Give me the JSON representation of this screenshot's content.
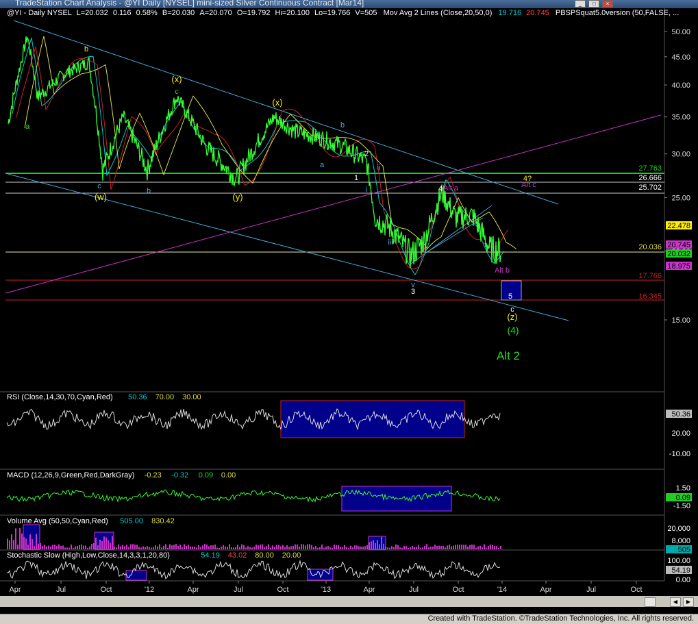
{
  "window": {
    "title": "TradeStation Chart Analysis - @YI Daily [NYSEL] mini-sized Silver Continuous Contract [Mar14]",
    "credit": "Created with TradeStation. ©TradeStation Technologies, Inc. All rights reserved."
  },
  "header": {
    "symbol": "@YI - Daily  NYSEL",
    "last": "L=20.032",
    "chg": "0.116",
    "pct": "0.58%",
    "bid": "B=20.030",
    "ask": "A=20.070",
    "open": "O=19.792",
    "hi": "Hi=20.100",
    "lo": "Lo=19.766",
    "vol": "V=505",
    "ma_label": "Mov Avg 2 Lines (Close,20,50,0)",
    "ma1": "19.716",
    "ma2": "20.745",
    "extra": "PBSPSquat5.0version (50,FALSE, ..."
  },
  "colors": {
    "price": "#33ff33",
    "fast_ma": "#00cccc",
    "slow_ma": "#cc2222",
    "long_ma": "#dddd44",
    "channel": "#44aadd",
    "trend_magenta": "#cc33cc",
    "support_green": "#22cc22",
    "support_red": "#cc2222",
    "label_yellow": "#ffee00",
    "label_green": "#22dd22",
    "panel_box": "#00008b"
  },
  "chart_data": [
    {
      "type": "line",
      "title": "@YI Daily price (mini-sized Silver)",
      "x": [
        "Apr'11",
        "Jul",
        "Oct",
        "'12",
        "Apr",
        "Jul",
        "Oct",
        "'13",
        "Apr",
        "Jul",
        "Oct",
        "'14"
      ],
      "series": [
        {
          "name": "Close",
          "values": [
            33,
            44,
            35,
            30,
            32,
            27,
            34,
            31,
            28,
            19.6,
            23,
            20.03
          ]
        }
      ],
      "ylim": [
        13,
        52
      ],
      "y_ticks": [
        "50.00",
        "45.00",
        "40.00",
        "35.00",
        "30.00",
        "25.00",
        "20.00",
        "15.00"
      ],
      "x_ticks": [
        "Apr",
        "Jul",
        "Oct",
        "'12",
        "Apr",
        "Jul",
        "Oct",
        "'13",
        "Apr",
        "Jul",
        "Oct",
        "'14",
        "Apr",
        "Jul",
        "Oct"
      ],
      "levels": [
        {
          "value": "27.763",
          "color": "#22cc22"
        },
        {
          "value": "26.666",
          "color": "#cccccc"
        },
        {
          "value": "25.702",
          "color": "#cccccc"
        },
        {
          "value": "22.478",
          "color": "#dddd44"
        },
        {
          "value": "20.745",
          "color": "#cc33cc"
        },
        {
          "value": "20.036",
          "color": "#dddd44"
        },
        {
          "value": "20.032",
          "color": "#22cc22"
        },
        {
          "value": "18.975",
          "color": "#cc33cc"
        },
        {
          "value": "17.766",
          "color": "#cc2222"
        },
        {
          "value": "16.345",
          "color": "#cc2222"
        }
      ],
      "annotations": [
        "a",
        "b",
        "c",
        "(w)",
        "b",
        "(x)",
        "c",
        "(y)",
        "(x)",
        "a",
        "b",
        "1",
        "2",
        "ii",
        "i",
        "iii",
        "v",
        "3",
        "4",
        "Alt a",
        "4?",
        "Alt c",
        "Alt b",
        "5",
        "c",
        "(z)",
        "(4)",
        "Alt 2"
      ]
    },
    {
      "type": "line",
      "title": "RSI (Close,14,30,70,Cyan,Red)",
      "values_text": [
        "50.36",
        "70.00",
        "30.00"
      ],
      "y_ticks": [
        "50.36",
        "20.00",
        "-10.00"
      ]
    },
    {
      "type": "line",
      "title": "MACD (12,26,9,Green,Red,DarkGray)",
      "values_text": [
        "-0.23",
        "-0.32",
        "0.09",
        "0.00"
      ],
      "y_ticks": [
        "1.50",
        "0.09",
        "-1.50"
      ]
    },
    {
      "type": "bar",
      "title": "Volume Avg (50,50,Cyan,Red)",
      "values_text": [
        "505.00",
        "830.42"
      ],
      "y_ticks": [
        "20,000",
        "8,000",
        "505"
      ]
    },
    {
      "type": "line",
      "title": "Stochastic Slow (High,Low,Close,14,3,3,1,20,80)",
      "values_text": [
        "54.19",
        "43.02",
        "80.00",
        "20.00"
      ],
      "y_ticks": [
        "100.00",
        "54.19",
        "0.00"
      ]
    }
  ]
}
